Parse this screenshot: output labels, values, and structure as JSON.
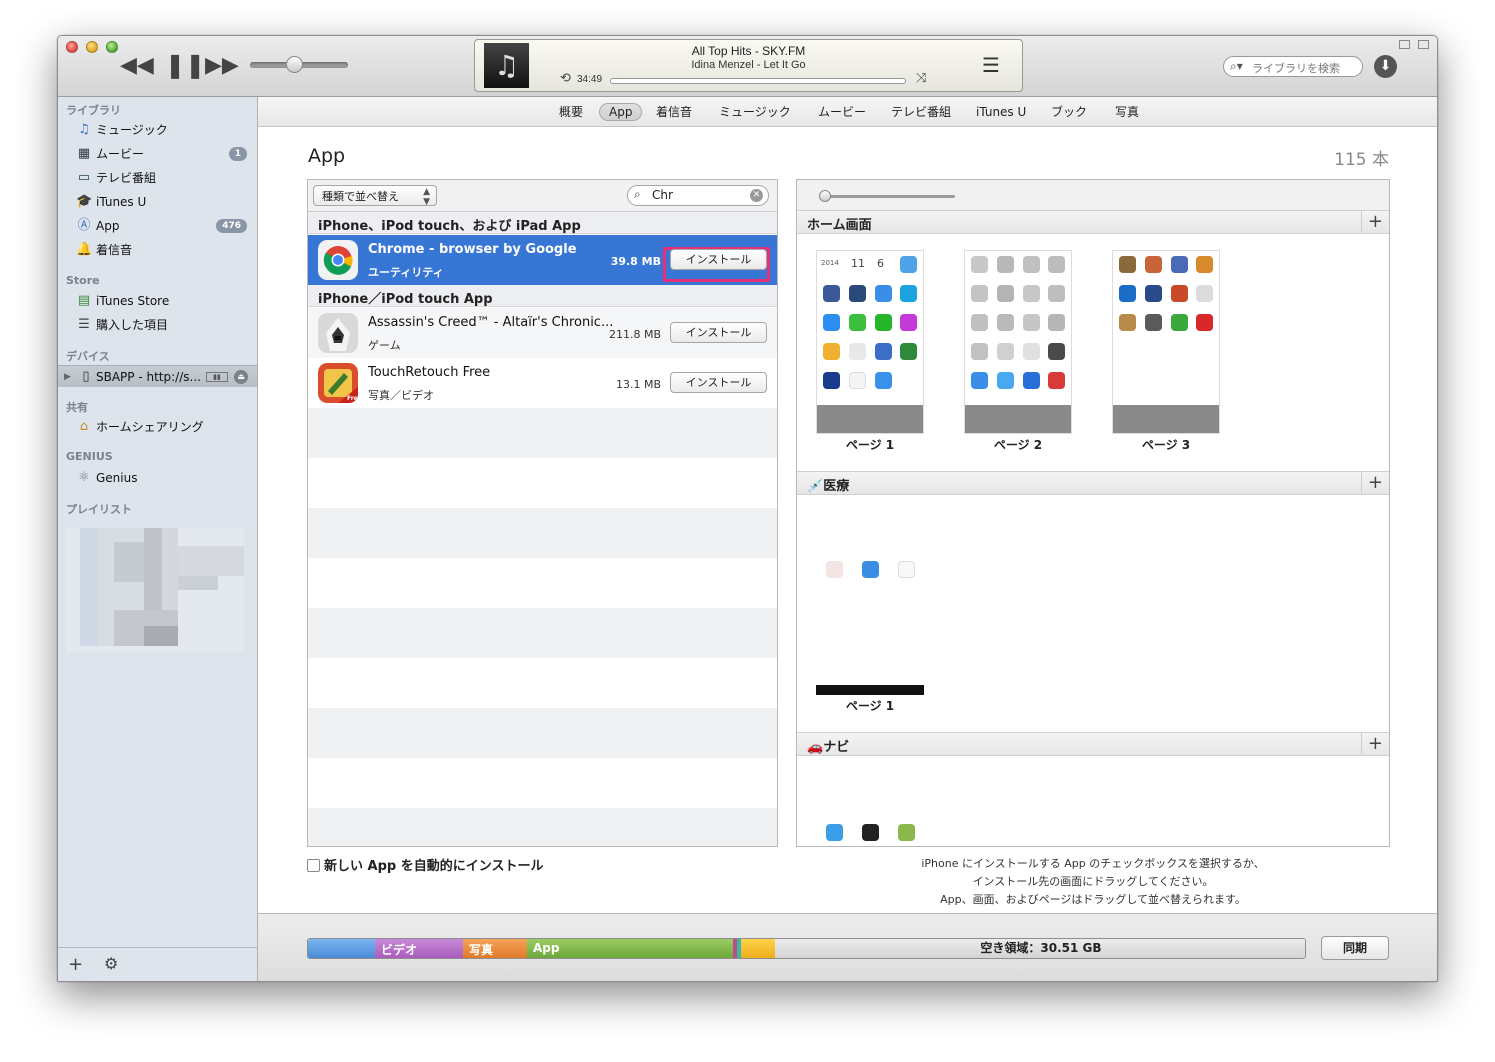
{
  "player": {
    "track_title": "All Top Hits - SKY.FM",
    "track_artist": "Idina Menzel - Let It Go",
    "elapsed": "34:49",
    "search_placeholder": "ライブラリを検索"
  },
  "sidebar": {
    "library_header": "ライブラリ",
    "library": [
      {
        "label": "ミュージック",
        "icon": "music-note-icon"
      },
      {
        "label": "ムービー",
        "icon": "film-icon",
        "badge": "1"
      },
      {
        "label": "テレビ番組",
        "icon": "tv-icon"
      },
      {
        "label": "iTunes U",
        "icon": "graduation-cap-icon"
      },
      {
        "label": "App",
        "icon": "app-store-icon",
        "badge": "476"
      },
      {
        "label": "着信音",
        "icon": "bell-icon"
      }
    ],
    "store_header": "Store",
    "store": [
      {
        "label": "iTunes Store",
        "icon": "store-icon"
      },
      {
        "label": "購入した項目",
        "icon": "purchased-list-icon"
      }
    ],
    "devices_header": "デバイス",
    "device": {
      "label": "SBAPP - http://s..."
    },
    "shared_header": "共有",
    "shared": [
      {
        "label": "ホームシェアリング",
        "icon": "home-icon"
      }
    ],
    "genius_header": "GENIUS",
    "genius": [
      {
        "label": "Genius",
        "icon": "genius-atom-icon"
      }
    ],
    "playlists_header": "プレイリスト"
  },
  "tabs": [
    {
      "label": "概要"
    },
    {
      "label": "App",
      "selected": true
    },
    {
      "label": "着信音"
    },
    {
      "label": "ミュージック"
    },
    {
      "label": "ムービー"
    },
    {
      "label": "テレビ番組"
    },
    {
      "label": "iTunes U"
    },
    {
      "label": "ブック"
    },
    {
      "label": "写真"
    }
  ],
  "apps": {
    "title": "App",
    "count": "115 本",
    "sort_label": "種類で並べ替え",
    "filter_value": "Chr",
    "group1": "iPhone、iPod touch、および iPad App",
    "group2": "iPhone／iPod touch App",
    "rows": [
      {
        "name": "Chrome - browser by Google",
        "category": "ユーティリティ",
        "size": "39.8 MB",
        "button": "インストール",
        "icon": "chrome-app-icon"
      },
      {
        "name": "Assassin's Creed™ - Altaïr's Chronic...",
        "category": "ゲーム",
        "size": "211.8 MB",
        "button": "インストール",
        "icon": "assassins-creed-app-icon"
      },
      {
        "name": "TouchRetouch Free",
        "category": "写真／ビデオ",
        "size": "13.1 MB",
        "button": "インストール",
        "icon": "touchretouch-app-icon"
      }
    ],
    "auto_install_label": "新しい App を自動的にインストール"
  },
  "home": {
    "section1": "ホーム画面",
    "section2": "医療",
    "section3": "ナビ",
    "pages": [
      "ページ 1",
      "ページ 2",
      "ページ 3"
    ],
    "page_single": "ページ 1",
    "help_line1": "iPhone にインストールする App のチェックボックスを選択するか、",
    "help_line2": "インストール先の画面にドラッグしてください。",
    "help_line3": "App、画面、およびページはドラッグして並べ替えられます。"
  },
  "capacity": {
    "video": "ビデオ",
    "photo": "写真",
    "app": "App",
    "free": "空き領域：30.51 GB",
    "sync": "同期"
  }
}
